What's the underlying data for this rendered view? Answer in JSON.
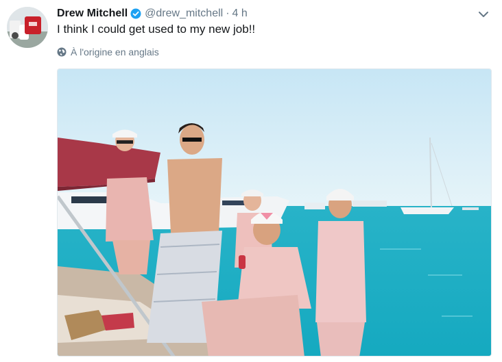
{
  "tweet": {
    "author_name": "Drew Mitchell",
    "author_handle": "@drew_mitchell",
    "separator": "·",
    "time": "4 h",
    "text": "I think I could get used to my new job!!",
    "translate_label": "À l'origine en anglais",
    "avatar_alt": "Drew Mitchell avatar",
    "photo_alt": "Men on a boat deck in sunny sea with yachts"
  },
  "icons": {
    "verified": "verified-badge-icon",
    "caret": "chevron-down-icon",
    "globe": "globe-icon"
  },
  "colors": {
    "text_primary": "#14171a",
    "text_secondary": "#657786",
    "verified_blue": "#1da1f2",
    "sea": "#1fb7c9",
    "sky": "#dbeef7"
  }
}
